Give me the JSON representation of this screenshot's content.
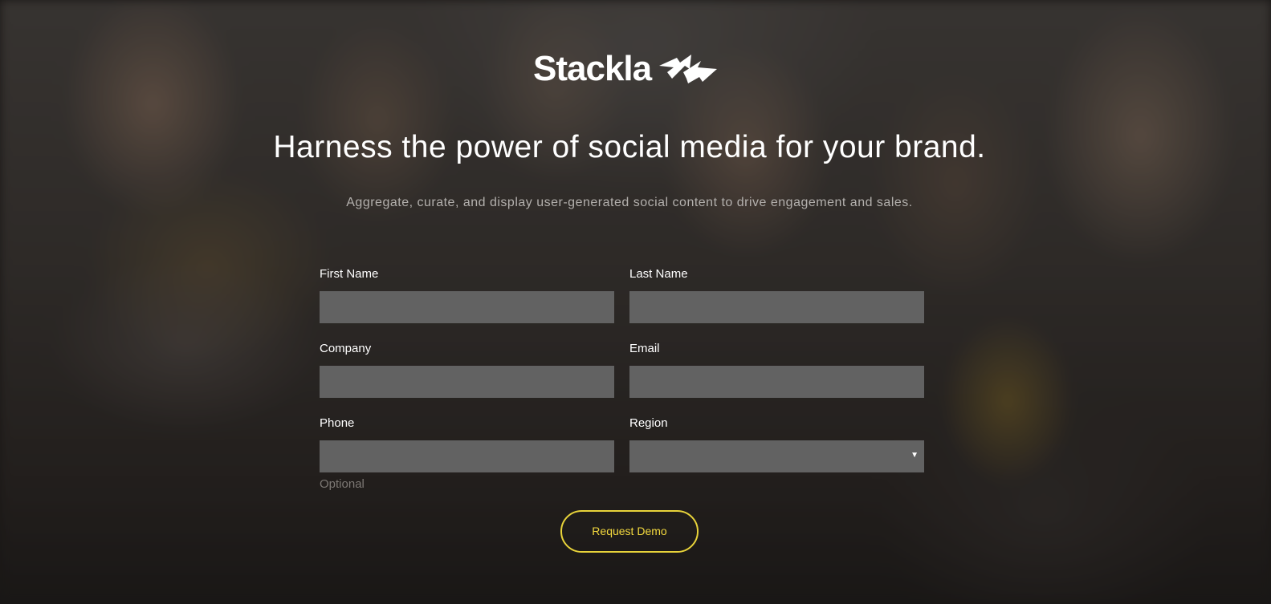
{
  "brand": {
    "name": "Stackla",
    "mark_icon": "stackla-arrows-icon",
    "accent_color": "#e8d33a"
  },
  "hero": {
    "headline": "Harness the power of social media for your brand.",
    "subheadline": "Aggregate, curate, and display user-generated social content to drive engagement and sales."
  },
  "form": {
    "first_name": {
      "label": "First Name",
      "value": ""
    },
    "last_name": {
      "label": "Last Name",
      "value": ""
    },
    "company": {
      "label": "Company",
      "value": ""
    },
    "email": {
      "label": "Email",
      "value": ""
    },
    "phone": {
      "label": "Phone",
      "value": "",
      "hint": "Optional"
    },
    "region": {
      "label": "Region",
      "selected": "",
      "icon": "dropdown-caret-icon"
    },
    "submit_label": "Request Demo"
  }
}
